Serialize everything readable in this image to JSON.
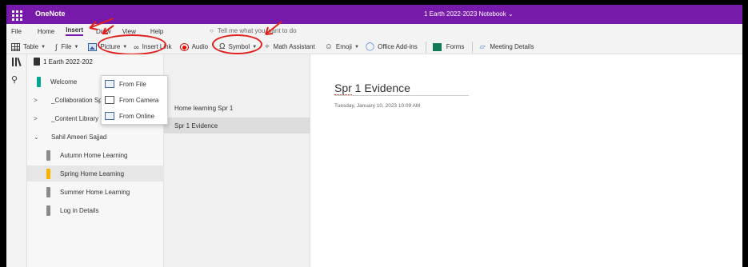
{
  "app": {
    "name": "OneNote",
    "notebook_title": "1 Earth 2022-2023 Notebook ⌄"
  },
  "menu": {
    "tabs": [
      {
        "label": "File"
      },
      {
        "label": "Home"
      },
      {
        "label": "Insert"
      },
      {
        "label": "Draw"
      },
      {
        "label": "View"
      },
      {
        "label": "Help"
      }
    ],
    "tell_me": "Tell me what you want to do"
  },
  "ribbon": {
    "table": "Table",
    "file": "File",
    "picture": "Picture",
    "insert_link": "Insert Link",
    "audio": "Audio",
    "symbol": "Symbol",
    "math": "Math Assistant",
    "emoji": "Emoji",
    "addins": "Office Add-ins",
    "forms": "Forms",
    "meeting": "Meeting Details"
  },
  "picture_menu": [
    {
      "label": "From File"
    },
    {
      "label": "From Camera"
    },
    {
      "label": "From Online"
    }
  ],
  "notebook": {
    "name": "1 Earth 2022-202",
    "sections": [
      {
        "label": "Welcome"
      },
      {
        "label": "_Collaboration Sp"
      },
      {
        "label": "_Content Library"
      },
      {
        "label": "Sahil Ameeri Sajjad"
      },
      {
        "label": "Autumn Home Learning"
      },
      {
        "label": "Spring Home Learning"
      },
      {
        "label": "Summer Home Learning"
      },
      {
        "label": "Log in Details"
      }
    ]
  },
  "pages": [
    {
      "label": "Home learning Spr 1"
    },
    {
      "label": "Spr 1 Evidence"
    }
  ],
  "page": {
    "title_prefix": "Spr",
    "title_rest": " 1 Evidence",
    "date": "Tuesday, January 10, 2023    10:09 AM"
  },
  "colors": {
    "brand": "#7719aa",
    "annotation": "#e0201c",
    "welcome_tab": "#00a88f",
    "spring_tab": "#f5b400",
    "group_tab": "#8a8a8a"
  }
}
